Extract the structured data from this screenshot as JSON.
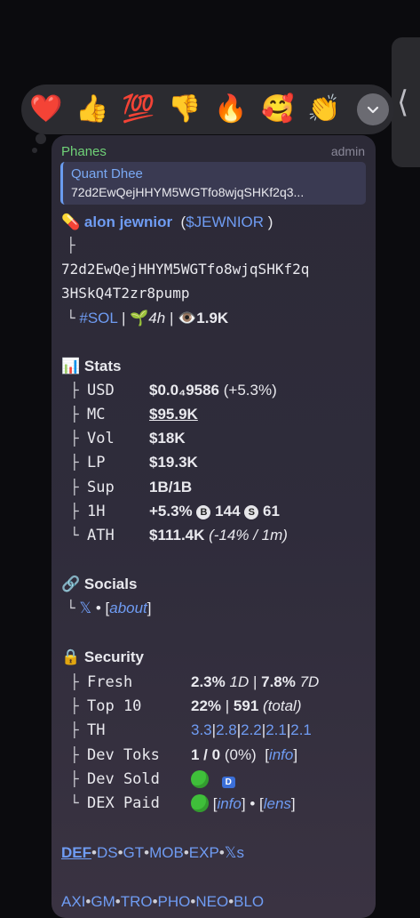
{
  "reactions": {
    "emojis": [
      "❤️",
      "👍",
      "💯",
      "👎",
      "🔥",
      "🥰",
      "👏"
    ],
    "more_icon": "chevron-down-icon"
  },
  "side_tab": {
    "icon": "chevron-left-icon",
    "glyph": "⟨"
  },
  "message": {
    "sender": "Phanes",
    "role": "admin",
    "quote": {
      "name": "Quant Dhee",
      "text": "72d2EwQejHHYM5WGTfo8wjqSHKf2q3..."
    },
    "token_emoji": "💊",
    "token_name": "alon jewnior",
    "token_ticker": "$JEWNIOR",
    "tree_mid": "├",
    "tree_end": "└",
    "address_line1": "72d2EwQejHHYM5WGTfo8wjqSHKf2q",
    "address_line2": "3HSkQ4T2zr8pump",
    "chain": "#SOL",
    "sprout": "🌱",
    "age": "4h",
    "eye": "👁️",
    "views": "1.9K",
    "stats": {
      "emoji": "📊",
      "title": "Stats",
      "usd_key": "USD",
      "usd_val": "$0.0₄9586",
      "usd_change": "(+5.3%)",
      "mc_key": "MC",
      "mc_val": "$95.9K",
      "vol_key": "Vol",
      "vol_val": "$18K",
      "lp_key": "LP",
      "lp_val": "$19.3K",
      "sup_key": "Sup",
      "sup_val": "1B/1B",
      "h1_key": "1H",
      "h1_change": "+5.3%",
      "buy_badge": "B",
      "buys": "144",
      "sell_badge": "S",
      "sells": "61",
      "ath_key": "ATH",
      "ath_val": "$111.4K",
      "ath_extra": "(-14% / 1m)"
    },
    "socials": {
      "emoji": "🔗",
      "title": "Socials",
      "x_link": "𝕏",
      "dot": "•",
      "about": "about"
    },
    "security": {
      "emoji": "🔒",
      "title": "Security",
      "fresh_key": "Fresh",
      "fresh_a": "2.3%",
      "fresh_a_period": "1D",
      "fresh_b": "7.8%",
      "fresh_b_period": "7D",
      "top10_key": "Top 10",
      "top10_pct": "22%",
      "top10_count": "591",
      "top10_note": "(total)",
      "th_key": "TH",
      "th_vals": [
        "3.3",
        "2.8",
        "2.2",
        "2.1",
        "2.1"
      ],
      "devtoks_key": "Dev Toks",
      "devtoks_val": "1 / 0",
      "devtoks_pct": "(0%)",
      "devtoks_link": "info",
      "devsold_key": "Dev Sold",
      "devsold_badge": "D",
      "dexpaid_key": "DEX Paid",
      "dexpaid_info": "info",
      "dexpaid_lens": "lens"
    },
    "links_row1": [
      "DEF",
      "DS",
      "GT",
      "MOB",
      "EXP",
      "𝕏s"
    ],
    "links_row2": [
      "AXI",
      "GM",
      "TRO",
      "PHO",
      "NEO",
      "BLO"
    ],
    "link_sep": "•",
    "pipe": "|"
  },
  "colors": {
    "link": "#6f9cf3",
    "sender": "#6fd177",
    "bubble": "#2c2a37",
    "status_dot": "#3fbf3a"
  }
}
